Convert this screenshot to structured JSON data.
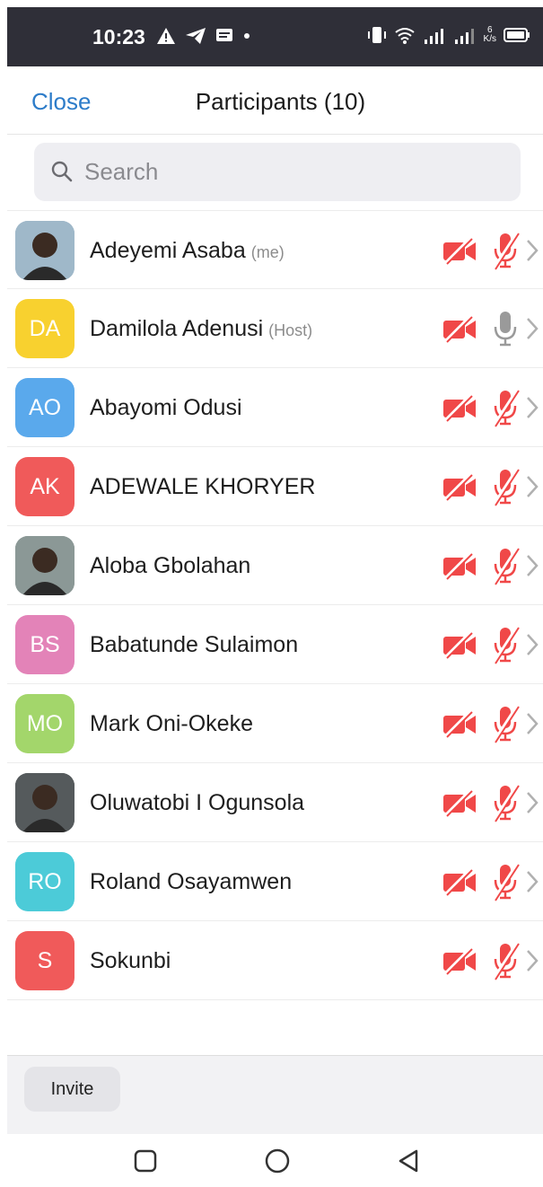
{
  "statusbar": {
    "time": "10:23",
    "net_speed_top": "6",
    "net_speed_bottom": "K/s"
  },
  "header": {
    "close_label": "Close",
    "title": "Participants (10)"
  },
  "search": {
    "placeholder": "Search"
  },
  "participants": [
    {
      "name": "Adeyemi Asaba",
      "tag": "(me)",
      "initials": "",
      "color": "#9fb8c9",
      "photo": true,
      "mic_muted": true
    },
    {
      "name": "Damilola Adenusi",
      "tag": "(Host)",
      "initials": "DA",
      "color": "#f8d12f",
      "photo": false,
      "mic_muted": false
    },
    {
      "name": "Abayomi Odusi",
      "tag": "",
      "initials": "AO",
      "color": "#5aa9ec",
      "photo": false,
      "mic_muted": true
    },
    {
      "name": "ADEWALE KHORYER",
      "tag": "",
      "initials": "AK",
      "color": "#f05a5a",
      "photo": false,
      "mic_muted": true
    },
    {
      "name": "Aloba Gbolahan",
      "tag": "",
      "initials": "",
      "color": "#8b9896",
      "photo": true,
      "mic_muted": true
    },
    {
      "name": "Babatunde Sulaimon",
      "tag": "",
      "initials": "BS",
      "color": "#e383b8",
      "photo": false,
      "mic_muted": true
    },
    {
      "name": "Mark Oni-Okeke",
      "tag": "",
      "initials": "MO",
      "color": "#a3d66b",
      "photo": false,
      "mic_muted": true
    },
    {
      "name": "Oluwatobi I Ogunsola",
      "tag": "",
      "initials": "",
      "color": "#555a5c",
      "photo": true,
      "mic_muted": true
    },
    {
      "name": "Roland Osayamwen",
      "tag": "",
      "initials": "RO",
      "color": "#4ccbd8",
      "photo": false,
      "mic_muted": true
    },
    {
      "name": "Sokunbi",
      "tag": "",
      "initials": "S",
      "color": "#f05a5a",
      "photo": false,
      "mic_muted": true
    }
  ],
  "footer": {
    "invite_label": "Invite"
  },
  "colors": {
    "accent": "#2d7cc9",
    "muted_red": "#f04848",
    "mic_grey": "#9a9a9a"
  }
}
